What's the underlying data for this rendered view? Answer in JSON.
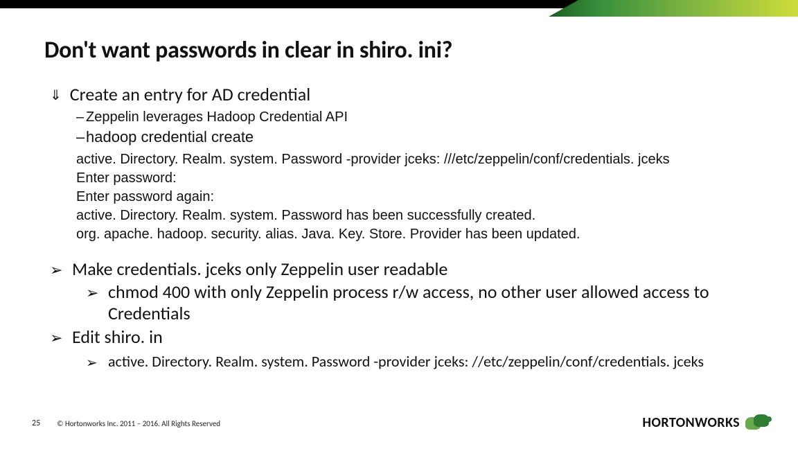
{
  "slide": {
    "title": "Don't want passwords in clear in shiro. ini?",
    "bullet1": {
      "text": "Create an entry for AD credential",
      "sub1": "Zeppelin leverages Hadoop Credential API",
      "sub2": "hadoop credential create",
      "code": {
        "l1": "active. Directory. Realm. system. Password -provider jceks: ///etc/zeppelin/conf/credentials. jceks",
        "l2": "Enter password:",
        "l3": "Enter password again:",
        "l4": "active. Directory. Realm. system. Password has been successfully created.",
        "l5": "org. apache. hadoop. security. alias. Java. Key. Store. Provider has been updated."
      }
    },
    "bullet2": {
      "text": "Make credentials. jceks only Zeppelin user readable",
      "sub": "chmod 400 with only Zeppelin process r/w access, no other user allowed access to Credentials"
    },
    "bullet3": {
      "text": "Edit shiro. in",
      "sub": "active. Directory. Realm. system. Password -provider jceks: //etc/zeppelin/conf/credentials. jceks"
    }
  },
  "footer": {
    "page": "25",
    "copyright": "© Hortonworks Inc. 2011 – 2016. All Rights Reserved"
  },
  "brand": {
    "name": "HORTONWORKS"
  },
  "icons": {
    "down_arrow": "⇓",
    "chevron": "➢",
    "dash": "–"
  }
}
